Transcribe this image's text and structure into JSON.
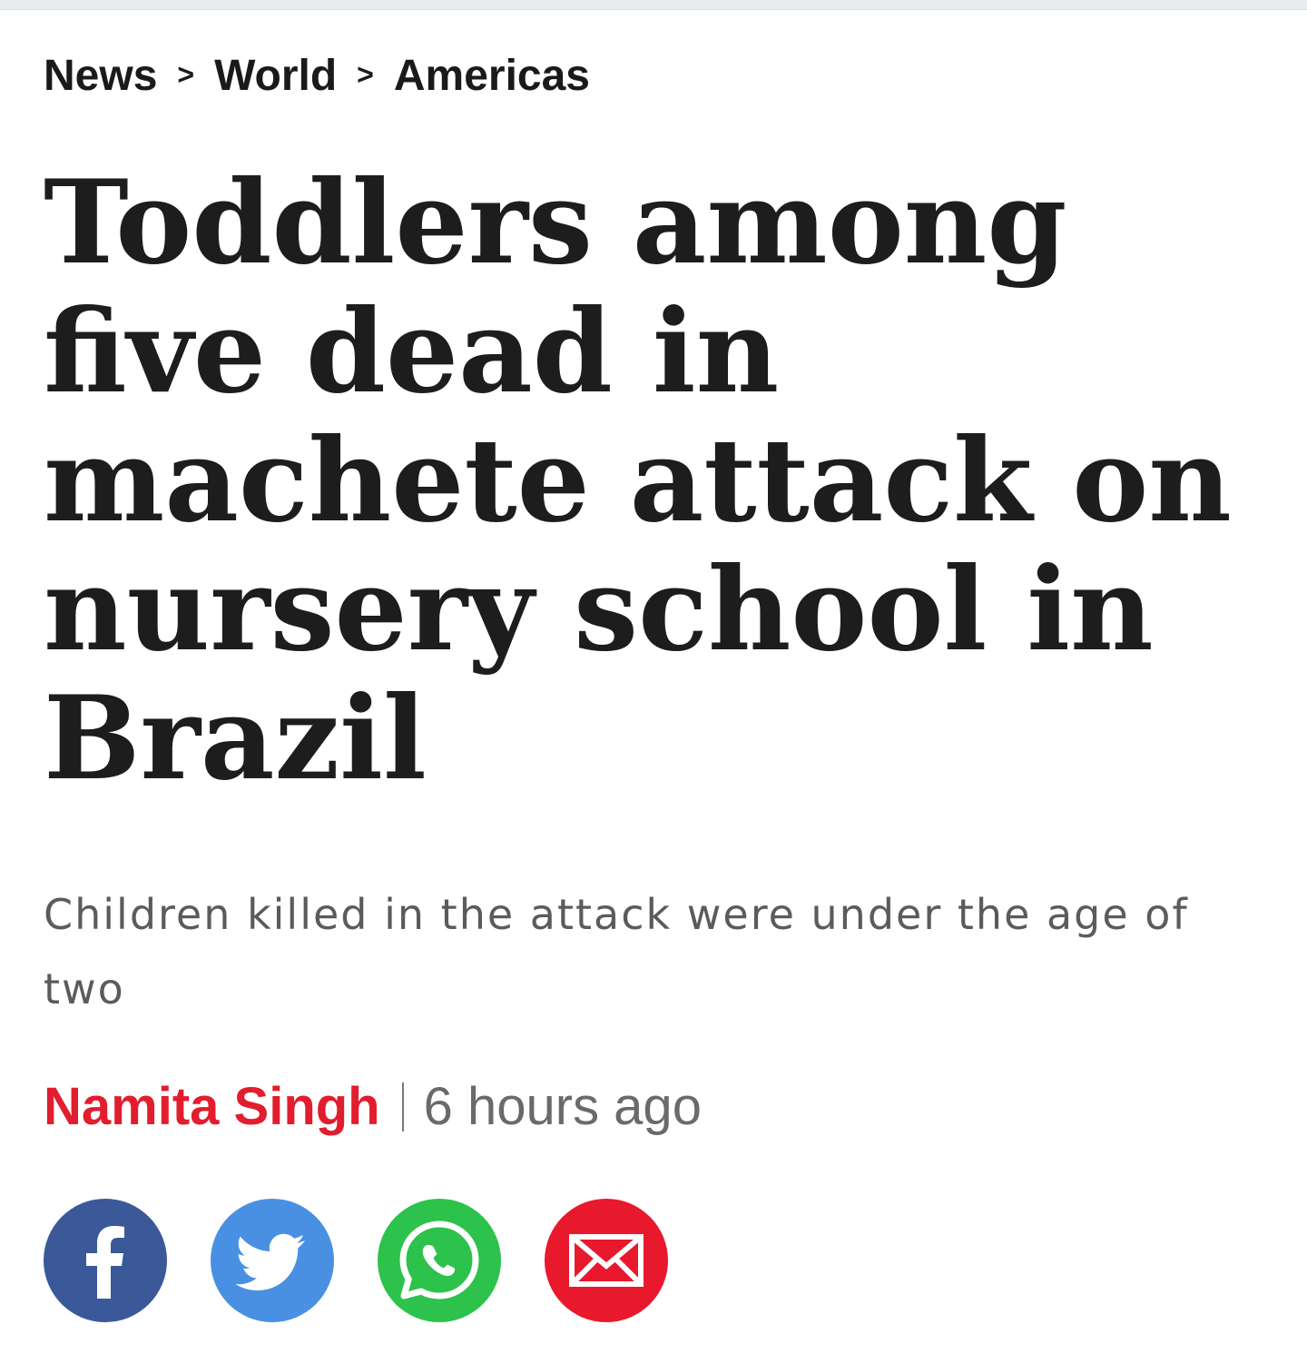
{
  "breadcrumb": {
    "items": [
      "News",
      "World",
      "Americas"
    ],
    "separator": ">"
  },
  "article": {
    "headline": "Toddlers among five dead in machete attack on nursery school in Brazil",
    "standfirst": "Children killed in the attack were under the age of two",
    "author": "Namita Singh",
    "timestamp": "6 hours ago"
  },
  "share": {
    "buttons": [
      {
        "network": "facebook",
        "icon": "facebook-icon",
        "color": "#3b5998"
      },
      {
        "network": "twitter",
        "icon": "twitter-icon",
        "color": "#4a90e2"
      },
      {
        "network": "whatsapp",
        "icon": "whatsapp-icon",
        "color": "#2dc24b"
      },
      {
        "network": "email",
        "icon": "email-icon",
        "color": "#e8192c"
      }
    ]
  },
  "colors": {
    "accent": "#e11d2e",
    "text": "#1d1d1d",
    "muted": "#5b5b5b"
  }
}
